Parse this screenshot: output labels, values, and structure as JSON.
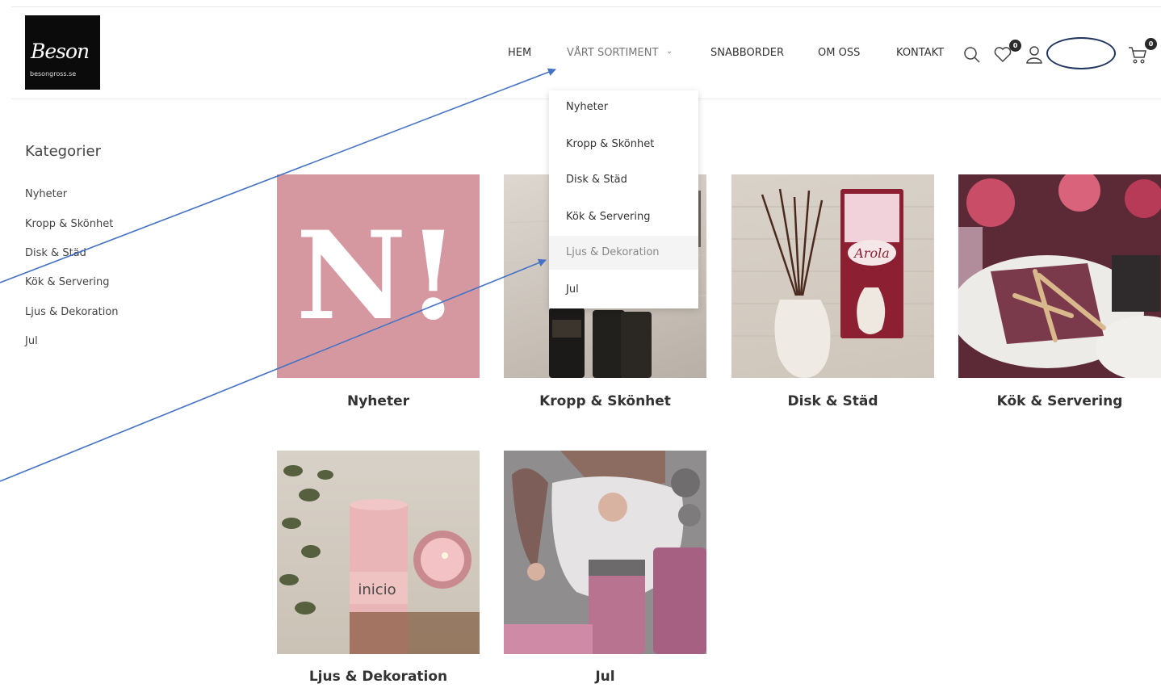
{
  "logo": {
    "script": "Beson",
    "url": "besongross.se"
  },
  "nav": {
    "items": [
      "HEM",
      "VÅRT SORTIMENT",
      "SNABBORDER",
      "OM OSS",
      "KONTAKT"
    ],
    "wishlist_count": "0",
    "cart_count": "0"
  },
  "dropdown": {
    "items": [
      "Nyheter",
      "Kropp & Skönhet",
      "Disk & Städ",
      "Kök & Servering",
      "Ljus & Dekoration",
      "Jul"
    ]
  },
  "sidebar": {
    "title": "Kategorier",
    "items": [
      "Nyheter",
      "Kropp & Skönhet",
      "Disk & Städ",
      "Kök & Servering",
      "Ljus & Dekoration",
      "Jul"
    ]
  },
  "categories": {
    "items": [
      "Nyheter",
      "Kropp & Skönhet",
      "Disk & Städ",
      "Kök & Servering",
      "Ljus & Dekoration",
      "Jul"
    ],
    "nyheter_mark": "N!",
    "arola_label": "Arola",
    "inicio_label": "inicio"
  },
  "colors": {
    "nyheter_bg": "#d598a0",
    "annotation": "#4472c4",
    "annotation_ellipse": "#20345f",
    "logo_bg": "#0b0b0b"
  }
}
